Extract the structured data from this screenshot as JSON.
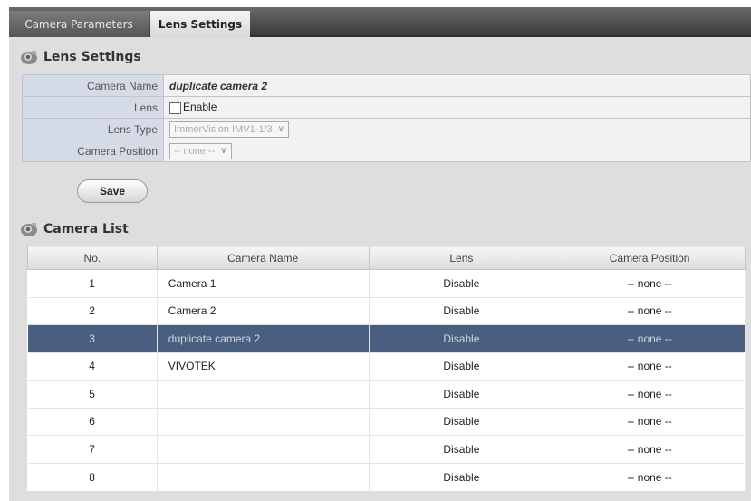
{
  "tabs": [
    {
      "label": "Camera Parameters"
    },
    {
      "label": "Lens Settings"
    }
  ],
  "lens_settings": {
    "title": "Lens Settings",
    "camera_name_label": "Camera Name",
    "camera_name_value": "duplicate camera 2",
    "lens_label": "Lens",
    "enable_label": "Enable",
    "lens_type_label": "Lens Type",
    "lens_type_value": "ImmerVision IMV1-1/3",
    "camera_position_label": "Camera Position",
    "camera_position_value": "-- none --",
    "save_label": "Save"
  },
  "camera_list": {
    "title": "Camera List",
    "columns": [
      "No.",
      "Camera Name",
      "Lens",
      "Camera Position"
    ],
    "rows": [
      {
        "no": "1",
        "name": "Camera 1",
        "lens": "Disable",
        "position": "-- none --"
      },
      {
        "no": "2",
        "name": "Camera 2",
        "lens": "Disable",
        "position": "-- none --"
      },
      {
        "no": "3",
        "name": "duplicate camera 2",
        "lens": "Disable",
        "position": "-- none --"
      },
      {
        "no": "4",
        "name": "VIVOTEK",
        "lens": "Disable",
        "position": "-- none --"
      },
      {
        "no": "5",
        "name": "",
        "lens": "Disable",
        "position": "-- none --"
      },
      {
        "no": "6",
        "name": "",
        "lens": "Disable",
        "position": "-- none --"
      },
      {
        "no": "7",
        "name": "",
        "lens": "Disable",
        "position": "-- none --"
      },
      {
        "no": "8",
        "name": "",
        "lens": "Disable",
        "position": "-- none --"
      }
    ]
  },
  "colors": {
    "selected_row": "#4a5e80",
    "label_cell": "#d4dbe6"
  }
}
